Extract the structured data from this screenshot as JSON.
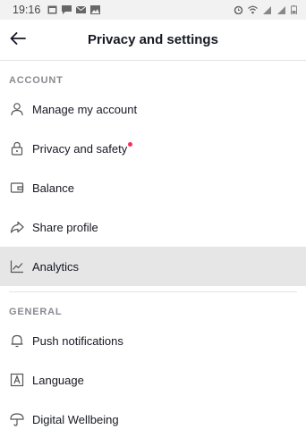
{
  "status_bar": {
    "time": "19:16",
    "left_icons": [
      "calendar-icon",
      "message-icon",
      "mail-icon",
      "image-icon"
    ],
    "right_icons": [
      "alarm-icon",
      "wifi-icon",
      "signal-icon",
      "signal-icon",
      "battery-icon"
    ]
  },
  "header": {
    "title": "Privacy and settings"
  },
  "sections": {
    "account": {
      "label": "ACCOUNT",
      "items": [
        {
          "label": "Manage my account",
          "icon": "person-icon"
        },
        {
          "label": "Privacy and safety",
          "icon": "lock-icon",
          "badge": true
        },
        {
          "label": "Balance",
          "icon": "wallet-icon"
        },
        {
          "label": "Share profile",
          "icon": "share-icon"
        },
        {
          "label": "Analytics",
          "icon": "analytics-icon",
          "active": true
        }
      ]
    },
    "general": {
      "label": "GENERAL",
      "items": [
        {
          "label": "Push notifications",
          "icon": "bell-icon"
        },
        {
          "label": "Language",
          "icon": "language-icon"
        },
        {
          "label": "Digital Wellbeing",
          "icon": "umbrella-icon"
        }
      ]
    }
  },
  "colors": {
    "badge": "#fe2c55",
    "active_row": "#e6e6e7",
    "text": "#161823",
    "section": "#8a8b91"
  }
}
